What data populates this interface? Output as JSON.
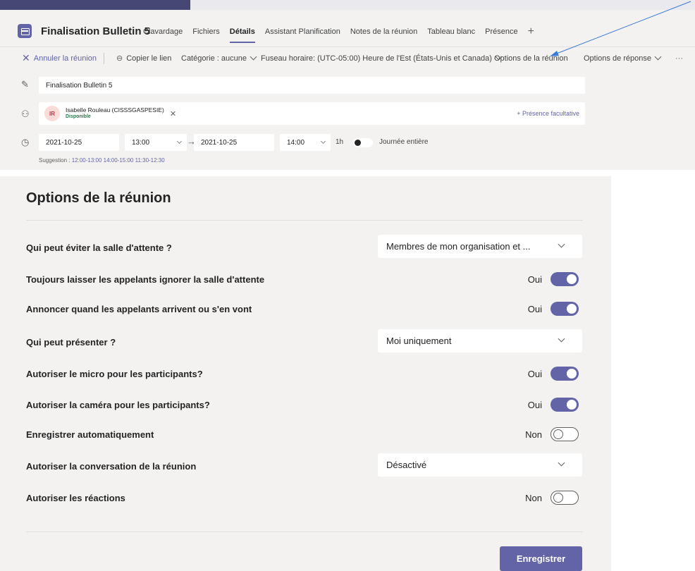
{
  "header": {
    "title": "Finalisation Bulletin 5",
    "tabs": [
      {
        "label": "Clavardage"
      },
      {
        "label": "Fichiers"
      },
      {
        "label": "Détails"
      },
      {
        "label": "Assistant Planification"
      },
      {
        "label": "Notes de la réunion"
      },
      {
        "label": "Tableau blanc"
      },
      {
        "label": "Présence"
      }
    ],
    "add_tab": "+"
  },
  "actions": {
    "cancel": "Annuler la réunion",
    "copy_link": "Copier le lien",
    "category": "Catégorie : aucune",
    "timezone": "Fuseau horaire: (UTC-05:00) Heure de l'Est (États-Unis et Canada)",
    "meeting_options": "Options de la réunion",
    "response_options": "Options de réponse",
    "more": "···"
  },
  "form": {
    "title_value": "Finalisation Bulletin 5",
    "attendee": {
      "initials": "IR",
      "name": "Isabelle Rouleau (CISSSGASPESIE)",
      "status": "Disponible"
    },
    "optional_label": "+ Présence facultative",
    "start_date": "2021-10-25",
    "start_time": "13:00",
    "end_date": "2021-10-25",
    "end_time": "14:00",
    "duration": "1h",
    "all_day_label": "Journée entière",
    "suggestion_label": "Suggestion :",
    "suggestions": [
      "12:00-13:00",
      "14:00-15:00",
      "11:30-12:30"
    ]
  },
  "options_panel": {
    "title": "Options de la réunion",
    "rows": [
      {
        "label": "Qui peut éviter la salle d'attente ?",
        "value": "Membres de mon organisation et ..."
      },
      {
        "label": "Toujours laisser les appelants ignorer la salle d'attente",
        "value": "Oui",
        "on": true
      },
      {
        "label": "Annoncer quand les appelants arrivent ou s'en vont",
        "value": "Oui",
        "on": true
      },
      {
        "label": "Qui peut présenter ?",
        "value": "Moi uniquement"
      },
      {
        "label": "Autoriser le micro pour les participants?",
        "value": "Oui",
        "on": true
      },
      {
        "label": "Autoriser la caméra pour les participants?",
        "value": "Oui",
        "on": true
      },
      {
        "label": "Enregistrer automatiquement",
        "value": "Non",
        "on": false
      },
      {
        "label": "Autoriser la conversation de la réunion",
        "value": "Désactivé"
      },
      {
        "label": "Autoriser les réactions",
        "value": "Non",
        "on": false
      }
    ],
    "save_label": "Enregistrer"
  },
  "colors": {
    "accent": "#6264a7",
    "panel_bg": "#f3f2f1",
    "available": "#237b4b",
    "annotation_arrow": "#3a7bd5"
  }
}
